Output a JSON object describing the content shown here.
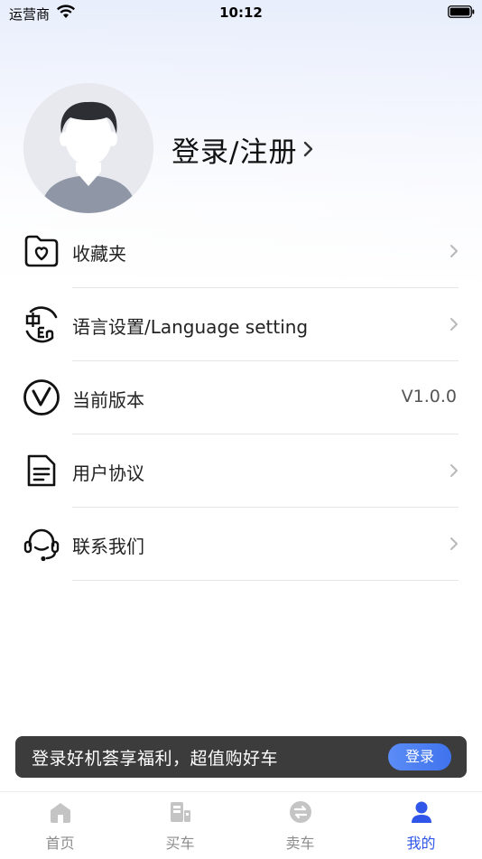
{
  "status_bar": {
    "carrier": "运营商",
    "time": "10:12"
  },
  "profile": {
    "login_label": "登录/注册"
  },
  "menu": [
    {
      "label": "收藏夹",
      "icon": "favorites-folder-icon",
      "value": ""
    },
    {
      "label": "语言设置/Language setting",
      "icon": "language-icon",
      "value": ""
    },
    {
      "label": "当前版本",
      "icon": "version-icon",
      "value": "V1.0.0"
    },
    {
      "label": "用户协议",
      "icon": "document-icon",
      "value": ""
    },
    {
      "label": "联系我们",
      "icon": "headset-icon",
      "value": ""
    }
  ],
  "banner": {
    "text": "登录好机荟享福利，超值购好车",
    "button": "登录"
  },
  "tabbar": [
    {
      "label": "首页",
      "icon": "home-icon"
    },
    {
      "label": "买车",
      "icon": "buy-car-icon"
    },
    {
      "label": "卖车",
      "icon": "sell-car-icon"
    },
    {
      "label": "我的",
      "icon": "profile-icon",
      "active": true
    }
  ],
  "colors": {
    "accent": "#2f56e8",
    "banner_bg": "#3c3c3d",
    "inactive_tab": "#8c8c8c"
  }
}
